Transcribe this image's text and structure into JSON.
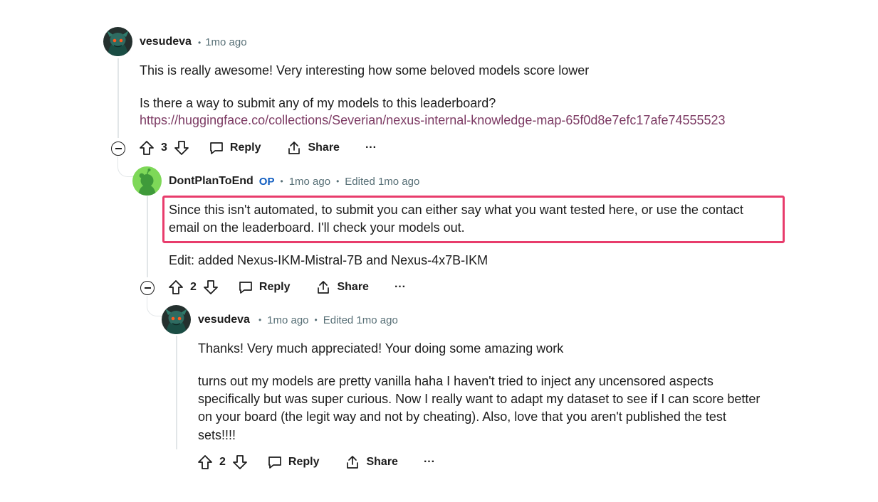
{
  "comments": [
    {
      "username": "vesudeva",
      "op_badge": "",
      "timestamp": "1mo ago",
      "edited": "",
      "body": [
        "This is really awesome! Very interesting how some beloved models score lower",
        "Is there a way to submit any of my models to this leaderboard?"
      ],
      "link": "https://huggingface.co/collections/Severian/nexus-internal-knowledge-map-65f0d8e7efc17afe74555523",
      "score": "3"
    },
    {
      "username": "DontPlanToEnd",
      "op_badge": "OP",
      "timestamp": "1mo ago",
      "edited": "Edited 1mo ago",
      "body": [
        "Since this isn't automated, to submit you can either say what you want tested here, or use the contact",
        "email on the leaderboard. I'll check your models out.",
        "Edit: added Nexus-IKM-Mistral-7B and Nexus-4x7B-IKM"
      ],
      "score": "2"
    },
    {
      "username": "vesudeva",
      "op_badge": "",
      "timestamp": "1mo ago",
      "edited": "Edited 1mo ago",
      "body": [
        "Thanks! Very much appreciated! Your doing some amazing work",
        "turns out my models are pretty vanilla haha I haven't tried to inject any uncensored aspects",
        "specifically but was super curious. Now I really want to adapt my dataset to see if I can score better",
        "on your board (the legit way and not by cheating). Also, love that you aren't published the test",
        "sets!!!!"
      ],
      "score": "2"
    }
  ],
  "actions": {
    "reply": "Reply",
    "share": "Share",
    "more": "···"
  },
  "colors": {
    "highlight": "#e83c6c",
    "op_badge": "#0f5cc0",
    "link": "#7c3a63",
    "meta": "#576f76"
  }
}
